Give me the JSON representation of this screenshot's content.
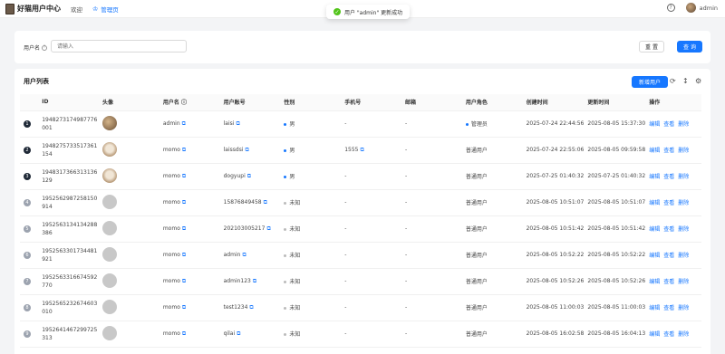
{
  "header": {
    "app_title": "好猫用户中心",
    "nav": [
      {
        "label": "欢迎"
      },
      {
        "label": "管理页"
      }
    ],
    "username": "admin"
  },
  "toast": {
    "message": "用户 \"admin\" 更新成功"
  },
  "search": {
    "label": "用户名",
    "placeholder": "请输入",
    "reset_label": "重 置",
    "query_label": "查 询"
  },
  "table": {
    "title": "用户列表",
    "add_label": "新增用户",
    "columns": [
      "ID",
      "头像",
      "用户名",
      "用户账号",
      "性别",
      "手机号",
      "邮箱",
      "用户角色",
      "创建时间",
      "更新时间",
      "操作"
    ],
    "actions": [
      "编辑",
      "查看",
      "删除"
    ],
    "rows": [
      {
        "no": "1",
        "id": "1948273174987776001",
        "avatar": "img1",
        "username": "admin",
        "account": "laisi",
        "gender": "男",
        "phone": "-",
        "email": "-",
        "role": "管理员",
        "created": "2025-07-24 22:44:56",
        "updated": "2025-08-05 15:37:30"
      },
      {
        "no": "2",
        "id": "1948275733517361154",
        "avatar": "img2",
        "username": "momo",
        "account": "laissdsi",
        "gender": "男",
        "phone": "1555",
        "email": "-",
        "role": "普通用户",
        "created": "2025-07-24 22:55:06",
        "updated": "2025-08-05 09:59:58"
      },
      {
        "no": "3",
        "id": "1948317366313136129",
        "avatar": "img2",
        "username": "momo",
        "account": "dogyupi",
        "gender": "男",
        "phone": "-",
        "email": "-",
        "role": "普通用户",
        "created": "2025-07-25 01:40:32",
        "updated": "2025-07-25 01:40:32"
      },
      {
        "no": "4",
        "id": "1952562987258150914",
        "avatar": "none",
        "username": "momo",
        "account": "15876849458",
        "gender": "未知",
        "phone": "-",
        "email": "-",
        "role": "普通用户",
        "created": "2025-08-05 10:51:07",
        "updated": "2025-08-05 10:51:07"
      },
      {
        "no": "5",
        "id": "1952563134134288386",
        "avatar": "none",
        "username": "momo",
        "account": "202103005217",
        "gender": "未知",
        "phone": "-",
        "email": "-",
        "role": "普通用户",
        "created": "2025-08-05 10:51:42",
        "updated": "2025-08-05 10:51:42"
      },
      {
        "no": "6",
        "id": "1952563301734481921",
        "avatar": "none",
        "username": "momo",
        "account": "admin",
        "gender": "未知",
        "phone": "-",
        "email": "-",
        "role": "普通用户",
        "created": "2025-08-05 10:52:22",
        "updated": "2025-08-05 10:52:22"
      },
      {
        "no": "7",
        "id": "1952563316674592770",
        "avatar": "none",
        "username": "momo",
        "account": "admin123",
        "gender": "未知",
        "phone": "-",
        "email": "-",
        "role": "普通用户",
        "created": "2025-08-05 10:52:26",
        "updated": "2025-08-05 10:52:26"
      },
      {
        "no": "8",
        "id": "1952565232674603010",
        "avatar": "none",
        "username": "momo",
        "account": "test1234",
        "gender": "未知",
        "phone": "-",
        "email": "-",
        "role": "普通用户",
        "created": "2025-08-05 11:00:03",
        "updated": "2025-08-05 11:00:03"
      },
      {
        "no": "9",
        "id": "1952641467299725313",
        "avatar": "none",
        "username": "momo",
        "account": "qilai",
        "gender": "未知",
        "phone": "-",
        "email": "-",
        "role": "普通用户",
        "created": "2025-08-05 16:02:58",
        "updated": "2025-08-05 16:04:13"
      }
    ]
  }
}
